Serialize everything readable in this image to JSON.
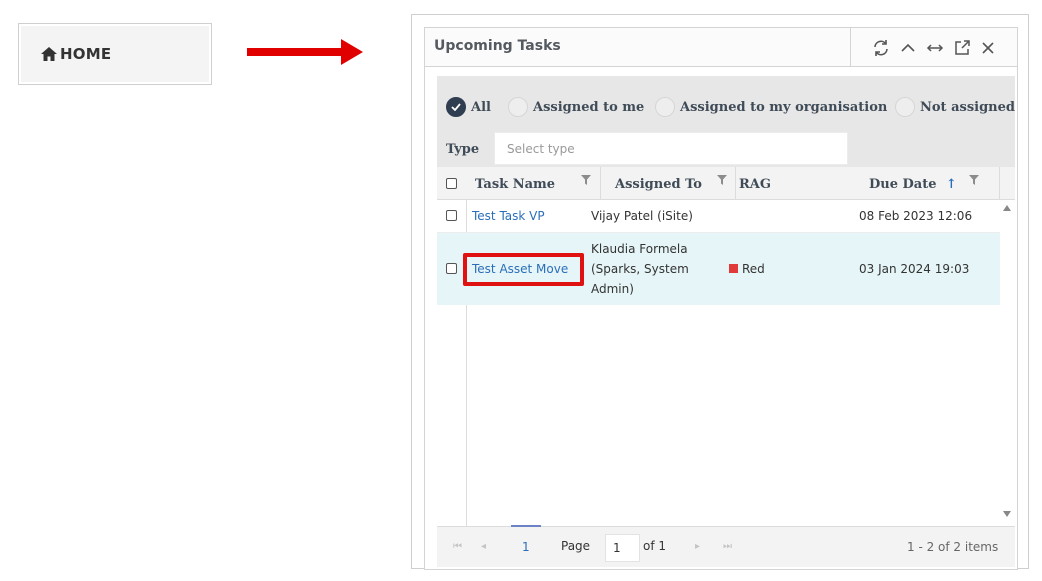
{
  "home": {
    "label": "HOME",
    "icon": "home-icon"
  },
  "widget": {
    "title": "Upcoming Tasks",
    "header_icons": [
      "refresh-icon",
      "collapse-icon",
      "expand-width-icon",
      "popout-icon",
      "close-icon"
    ],
    "filters": [
      {
        "label": "All",
        "checked": true
      },
      {
        "label": "Assigned to me",
        "checked": false
      },
      {
        "label": "Assigned to my organisation",
        "checked": false
      },
      {
        "label": "Not assigned",
        "checked": false
      }
    ],
    "type_label": "Type",
    "type_placeholder": "Select type",
    "columns": {
      "task_name": "Task Name",
      "assigned_to": "Assigned To",
      "rag": "RAG",
      "due_date": "Due Date",
      "sort_indicator": "↑"
    },
    "rows": [
      {
        "task_name": "Test Task VP",
        "assigned_to": "Vijay Patel (iSite)",
        "rag": "",
        "due_date": "08 Feb 2023 12:06"
      },
      {
        "task_name": "Test Asset Move",
        "assigned_to_lines": [
          "Klaudia Formela",
          "(Sparks, System",
          "Admin)"
        ],
        "rag": "Red",
        "rag_color": "#e03a3a",
        "due_date": "03 Jan 2024 19:03",
        "highlighted": true
      }
    ],
    "pager": {
      "current_page_link": "1",
      "page_label": "Page",
      "page_value": "1",
      "of_label": "of 1",
      "items_summary": "1 - 2 of 2 items"
    }
  },
  "colors": {
    "accent_link": "#2a6ebb",
    "highlight_red": "#e01111",
    "arrow_red": "#e00000",
    "radio_checked": "#2f3e50"
  }
}
